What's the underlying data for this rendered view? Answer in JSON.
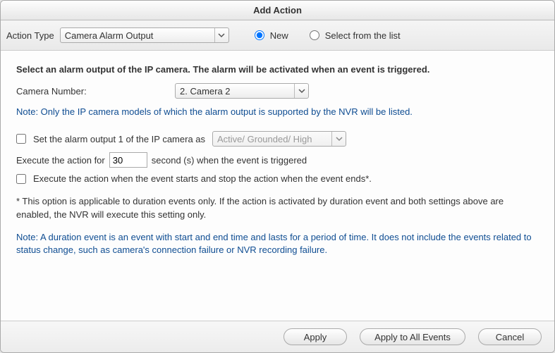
{
  "title": "Add Action",
  "typebar": {
    "label": "Action Type",
    "selected": "Camera Alarm Output",
    "radio_new": "New",
    "radio_list": "Select from the list"
  },
  "content": {
    "heading": "Select an alarm output of the IP camera. The alarm will be activated when an event is triggered.",
    "camera_label": "Camera Number:",
    "camera_selected": "2. Camera 2",
    "note1": "Note: Only the IP camera models of which the alarm output is supported by the NVR will be listed.",
    "cb1_label": "Set the alarm output 1 of the IP camera as",
    "cb1_select": "Active/ Grounded/ High",
    "exec_pre": "Execute the action for",
    "exec_value": "30",
    "exec_post": "second (s) when the event is triggered",
    "cb2_label": "Execute the action when the event starts and stop the action when the event ends*.",
    "footnote": "* This option is applicable to duration events only. If the action is activated by duration event and both settings above are enabled, the NVR will execute this setting only.",
    "note2": "Note: A duration event is an event with start and end time and lasts for a period of time. It does not include the events related to status change, such as camera's connection failure or NVR recording failure."
  },
  "buttons": {
    "apply": "Apply",
    "apply_all": "Apply to All Events",
    "cancel": "Cancel"
  }
}
